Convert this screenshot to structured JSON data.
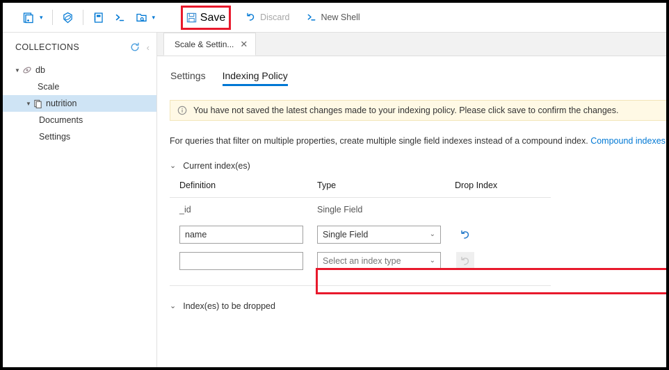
{
  "toolbar": {
    "items": [
      {
        "name": "new-collection",
        "label": "",
        "icon": "new-document-icon",
        "has_caret": true,
        "disabled": false
      },
      {
        "name": "open-query",
        "label": "",
        "icon": "cosmos-hexagon-icon",
        "has_caret": false,
        "disabled": false
      },
      {
        "name": "new-notebook",
        "label": "",
        "icon": "notebook-icon",
        "has_caret": false,
        "disabled": false
      },
      {
        "name": "new-terminal",
        "label": "",
        "icon": "terminal-icon",
        "has_caret": false,
        "disabled": false
      },
      {
        "name": "open-folder",
        "label": "",
        "icon": "open-folder-icon",
        "has_caret": true,
        "disabled": false
      }
    ],
    "save_label": "Save",
    "discard_label": "Discard",
    "new_shell_label": "New Shell",
    "highlight_color": "#e8192c"
  },
  "sidebar": {
    "title": "COLLECTIONS",
    "refresh_icon": "refresh-icon",
    "collapse_icon": "chevron-left-icon",
    "tree": [
      {
        "label": "db",
        "icon": "database-icon",
        "level": 0,
        "twisty": "expanded",
        "selected": false
      },
      {
        "label": "Scale",
        "icon": "",
        "level": 1,
        "twisty": "none",
        "selected": false
      },
      {
        "label": "nutrition",
        "icon": "collection-icon",
        "level": 1,
        "twisty": "expanded",
        "selected": true
      },
      {
        "label": "Documents",
        "icon": "",
        "level": 2,
        "twisty": "none",
        "selected": false
      },
      {
        "label": "Settings",
        "icon": "",
        "level": 2,
        "twisty": "none",
        "selected": false
      }
    ]
  },
  "content": {
    "document_tab": {
      "label": "Scale & Settin...",
      "close_icon": "close-icon"
    },
    "subtabs": [
      {
        "label": "Settings",
        "active": false
      },
      {
        "label": "Indexing Policy",
        "active": true
      }
    ],
    "banner": {
      "icon": "info-circle-icon",
      "text": "You have not saved the latest changes made to your indexing policy. Please click save to confirm the changes.",
      "background": "#fff9e5"
    },
    "description": {
      "text": "For queries that filter on multiple properties, create multiple single field indexes instead of a compound index. ",
      "link_text": "Compound indexes",
      "link_color": "#0078d4"
    },
    "current_section": {
      "caption": "Current index(es)",
      "caret": "chevron-down-icon",
      "columns": [
        "Definition",
        "Type",
        "Drop Index"
      ],
      "rows": [
        {
          "definition": "_id",
          "type": "Single Field",
          "editable": false
        }
      ],
      "edit_rows": [
        {
          "definition_value": "name",
          "definition_placeholder": "",
          "type_value": "Single Field",
          "type_is_placeholder": false,
          "undo_icon": "undo-icon",
          "undo_disabled": false,
          "highlighted": true
        },
        {
          "definition_value": "",
          "definition_placeholder": "",
          "type_value": "Select an index type",
          "type_is_placeholder": true,
          "undo_icon": "undo-icon",
          "undo_disabled": true,
          "highlighted": false
        }
      ]
    },
    "drop_section": {
      "caption": "Index(es) to be dropped",
      "caret": "chevron-down-icon"
    }
  }
}
